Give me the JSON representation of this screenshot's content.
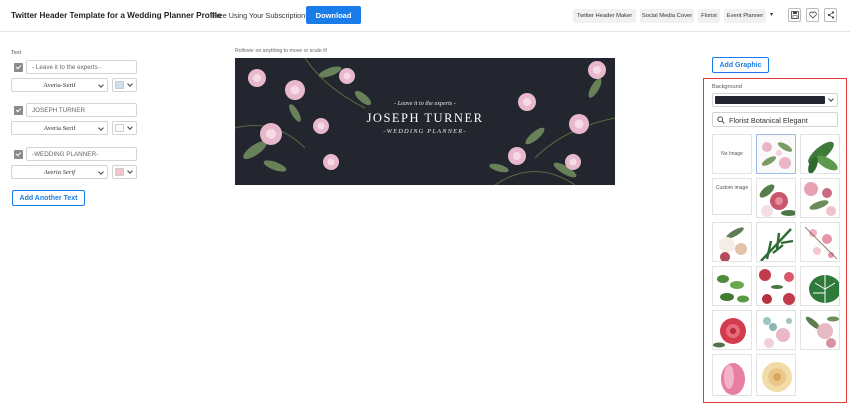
{
  "header": {
    "title": "Twitter Header Template for a Wedding Planner Profile",
    "subscription_note": "Free Using Your Subscription!",
    "download_label": "Download",
    "tags": [
      "Twitter Header Maker",
      "Social Media Cover",
      "Florist",
      "Event Planner"
    ],
    "tag_caret": "▾",
    "icons": [
      "save-icon",
      "heart-icon",
      "share-icon"
    ]
  },
  "text_panel": {
    "section_label": "Text",
    "items": [
      {
        "text": "- Leave it to the experts -",
        "font": "Averia-Serif",
        "color": "#cfe0ee"
      },
      {
        "text": "JOSEPH TURNER",
        "font": "Averia Serif",
        "color": "#ffffff"
      },
      {
        "text": "-WEDDING PLANNER-",
        "font": "Averia Serif",
        "color": "#f4c5cc"
      }
    ],
    "add_text_label": "Add Another Text"
  },
  "canvas": {
    "hint": "Rollover on anything to move or scale it!",
    "background_color": "#23262f",
    "line1": "- Leave it to the experts -",
    "line2": "JOSEPH TURNER",
    "line3": "-WEDDING PLANNER-"
  },
  "graphics_panel": {
    "add_graphic_label": "Add Graphic",
    "background_label": "Background",
    "background_color": "#23262f",
    "search_value": "Florist Botanical Elegant",
    "no_image_label": "No Image",
    "custom_image_label": "Custom image",
    "thumbnails": [
      "pink-blossom-branches",
      "tropical-leaves",
      "peony-bouquet",
      "pink-floral-corner",
      "white-lily-arrangement",
      "palm-leaves",
      "cherry-blossom",
      "green-leaf-sprigs",
      "red-roses-frame",
      "monstera-leaf",
      "red-rose",
      "eucalyptus-pink",
      "protea-bouquet",
      "pink-tulip",
      "cream-dahlia"
    ]
  },
  "colors": {
    "accent": "#1a7ce8",
    "highlight_border": "#e03a3a",
    "banner_bg": "#23262f"
  }
}
